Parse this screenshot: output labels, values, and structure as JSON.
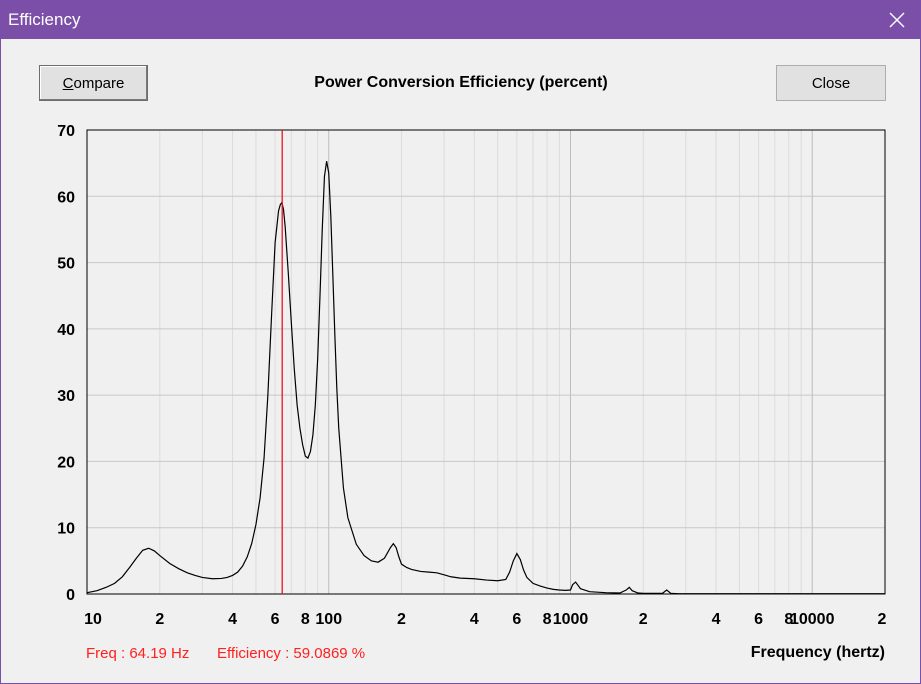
{
  "window": {
    "title": "Efficiency",
    "close_icon": "close-icon"
  },
  "toolbar": {
    "compare_label_accel": "C",
    "compare_label_rest": "ompare",
    "close_label": "Close"
  },
  "readout": {
    "freq": "Freq : 64.19 Hz",
    "efficiency": "Efficiency : 59.0869 %",
    "cursor_freq_hz": 64.19,
    "cursor_color": "#e8141e"
  },
  "chart_data": {
    "type": "line",
    "title": "Power Conversion Efficiency (percent)",
    "xlabel": "Frequency (hertz)",
    "ylabel": "",
    "xscale": "log",
    "xlim": [
      10,
      20000
    ],
    "ylim": [
      0,
      70
    ],
    "grid": true,
    "y_ticks": [
      0,
      10,
      20,
      30,
      40,
      50,
      60,
      70
    ],
    "x_ticks": [
      {
        "value": 10,
        "label": "10"
      },
      {
        "value": 20,
        "label": "2"
      },
      {
        "value": 40,
        "label": "4"
      },
      {
        "value": 60,
        "label": "6"
      },
      {
        "value": 80,
        "label": "8"
      },
      {
        "value": 100,
        "label": "100"
      },
      {
        "value": 200,
        "label": "2"
      },
      {
        "value": 400,
        "label": "4"
      },
      {
        "value": 600,
        "label": "6"
      },
      {
        "value": 800,
        "label": "8"
      },
      {
        "value": 1000,
        "label": "1000"
      },
      {
        "value": 2000,
        "label": "2"
      },
      {
        "value": 4000,
        "label": "4"
      },
      {
        "value": 6000,
        "label": "6"
      },
      {
        "value": 8000,
        "label": "8"
      },
      {
        "value": 10000,
        "label": "10000"
      },
      {
        "value": 20000,
        "label": "2"
      }
    ],
    "line_color": "#000000",
    "series": [
      {
        "x": [
          10,
          11,
          12,
          13,
          14,
          15,
          16,
          17,
          18,
          19,
          20,
          22,
          24,
          26,
          28,
          30,
          33,
          36,
          38,
          40,
          42,
          44,
          46,
          48,
          50,
          52,
          54,
          56,
          58,
          60,
          62,
          63,
          64,
          65,
          66,
          68,
          70,
          72,
          74,
          76,
          78,
          80,
          82,
          84,
          86,
          88,
          90,
          92,
          94,
          96,
          98,
          100,
          102,
          104,
          106,
          108,
          110,
          115,
          120,
          130,
          140,
          150,
          160,
          170,
          180,
          185,
          190,
          195,
          200,
          210,
          220,
          240,
          260,
          280,
          300,
          320,
          350,
          400,
          450,
          500,
          540,
          560,
          580,
          600,
          620,
          640,
          660,
          700,
          750,
          800,
          850,
          900,
          950,
          1000,
          1020,
          1050,
          1100,
          1200,
          1400,
          1600,
          1700,
          1750,
          1800,
          1900,
          2000,
          2200,
          2400,
          2500,
          2600,
          2800,
          3000,
          3500,
          4000,
          4500,
          5000,
          6000,
          8000,
          10000,
          12000,
          15000,
          20000
        ],
        "y": [
          0.2,
          0.5,
          1.0,
          1.6,
          2.6,
          4.0,
          5.4,
          6.6,
          6.9,
          6.5,
          5.8,
          4.6,
          3.8,
          3.2,
          2.8,
          2.5,
          2.3,
          2.35,
          2.5,
          2.8,
          3.3,
          4.2,
          5.6,
          7.6,
          10.5,
          14.5,
          20.5,
          30.0,
          42.0,
          53.0,
          57.8,
          58.7,
          59.08,
          58.0,
          55.5,
          48.5,
          41.0,
          34.0,
          28.5,
          25.0,
          22.5,
          20.8,
          20.5,
          21.5,
          24.0,
          28.5,
          35.5,
          45.0,
          55.0,
          63.0,
          65.3,
          63.5,
          57.0,
          48.0,
          39.0,
          31.0,
          25.0,
          16.0,
          11.5,
          7.5,
          5.8,
          5.0,
          4.8,
          5.4,
          7.0,
          7.6,
          7.0,
          5.6,
          4.5,
          4.0,
          3.7,
          3.4,
          3.3,
          3.2,
          2.9,
          2.6,
          2.4,
          2.3,
          2.1,
          2.0,
          2.2,
          3.3,
          5.0,
          6.1,
          5.2,
          3.6,
          2.5,
          1.6,
          1.2,
          0.9,
          0.7,
          0.6,
          0.55,
          0.6,
          1.4,
          1.8,
          0.8,
          0.35,
          0.2,
          0.15,
          0.6,
          1.0,
          0.5,
          0.15,
          0.1,
          0.1,
          0.1,
          0.6,
          0.1,
          0.05,
          0.05,
          0.05,
          0.05,
          0.05,
          0.05,
          0.05,
          0.05,
          0.05,
          0.05,
          0.05,
          0.05
        ]
      }
    ]
  }
}
